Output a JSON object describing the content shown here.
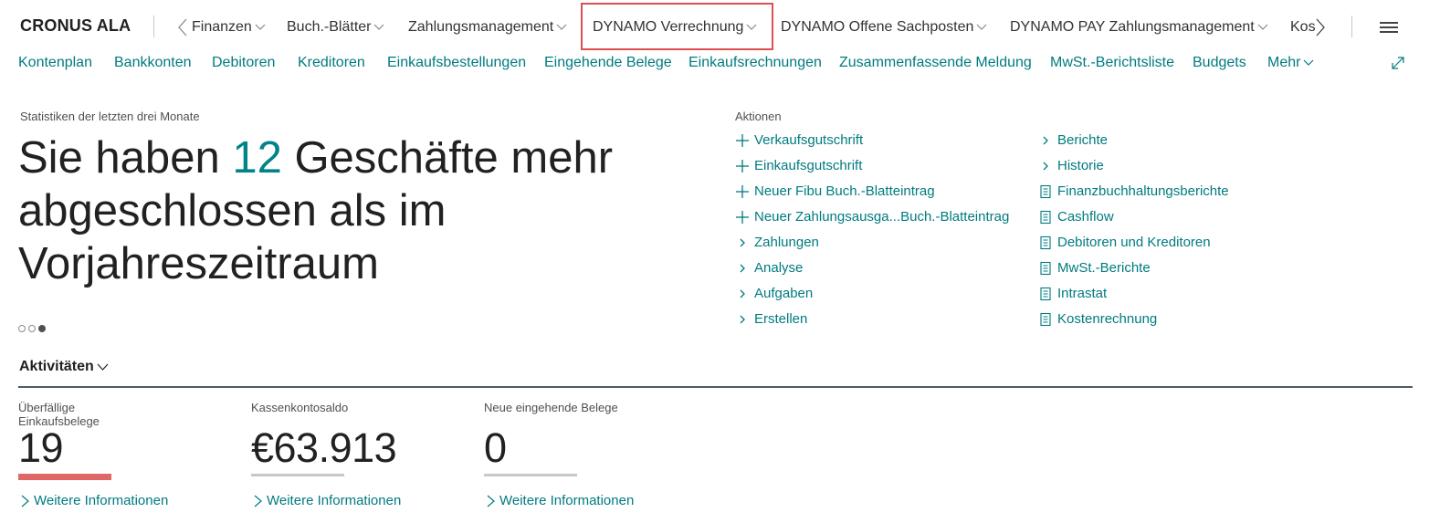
{
  "company": "CRONUS ALA",
  "top_menu": [
    {
      "label": "Finanzen"
    },
    {
      "label": "Buch.-Blätter"
    },
    {
      "label": "Zahlungsmanagement"
    },
    {
      "label": "DYNAMO Verrechnung"
    },
    {
      "label": "DYNAMO Offene Sachposten"
    },
    {
      "label": "DYNAMO PAY Zahlungsmanagement"
    },
    {
      "label": "Kos"
    }
  ],
  "sub_nav": [
    {
      "label": "Kontenplan"
    },
    {
      "label": "Bankkonten"
    },
    {
      "label": "Debitoren"
    },
    {
      "label": "Kreditoren"
    },
    {
      "label": "Einkaufsbestellungen"
    },
    {
      "label": "Eingehende Belege"
    },
    {
      "label": "Einkaufsrechnungen"
    },
    {
      "label": "Zusammenfassende Meldung"
    },
    {
      "label": "MwSt.-Berichtsliste"
    },
    {
      "label": "Budgets"
    },
    {
      "label": "Mehr"
    }
  ],
  "headline": {
    "caption": "Statistiken der letzten drei Monate",
    "prefix": "Sie haben ",
    "number": "12",
    "suffix": " Geschäfte mehr abgeschlossen als im Vorjahreszeitraum",
    "carousel_active_index": 3,
    "carousel_count": 3
  },
  "actions": {
    "caption": "Aktionen",
    "left": [
      {
        "label": "Verkaufsgutschrift",
        "icon": "plus-icon"
      },
      {
        "label": "Einkaufsgutschrift",
        "icon": "plus-icon"
      },
      {
        "label": "Neuer Fibu Buch.-Blatteintrag",
        "icon": "plus-icon"
      },
      {
        "label": "Neuer Zahlungsausga...Buch.-Blatteintrag",
        "icon": "plus-icon"
      },
      {
        "label": "Zahlungen",
        "icon": "chevron-right-icon"
      },
      {
        "label": "Analyse",
        "icon": "chevron-right-icon"
      },
      {
        "label": "Aufgaben",
        "icon": "chevron-right-icon"
      },
      {
        "label": "Erstellen",
        "icon": "chevron-right-icon"
      }
    ],
    "right": [
      {
        "label": "Berichte",
        "icon": "chevron-right-icon"
      },
      {
        "label": "Historie",
        "icon": "chevron-right-icon"
      },
      {
        "label": "Finanzbuchhaltungsberichte",
        "icon": "report-icon"
      },
      {
        "label": "Cashflow",
        "icon": "report-icon"
      },
      {
        "label": "Debitoren und Kreditoren",
        "icon": "report-icon"
      },
      {
        "label": "MwSt.-Berichte",
        "icon": "report-icon"
      },
      {
        "label": "Intrastat",
        "icon": "report-icon"
      },
      {
        "label": "Kostenrechnung",
        "icon": "report-icon"
      }
    ]
  },
  "activities": {
    "title": "Aktivitäten",
    "tiles": [
      {
        "label": "Überfällige Einkaufsbelege",
        "value": "19",
        "link": "Weitere Informationen",
        "status": "alert"
      },
      {
        "label": "Kassenkontosaldo",
        "value": "€63.913",
        "link": "Weitere Informationen",
        "status": "normal"
      },
      {
        "label": "Neue eingehende Belege",
        "value": "0",
        "link": "Weitere Informationen",
        "status": "normal"
      }
    ]
  },
  "colors": {
    "accent": "#008489",
    "link": "#007b80",
    "alert": "#e06767",
    "highlight": "#e04f4f"
  }
}
